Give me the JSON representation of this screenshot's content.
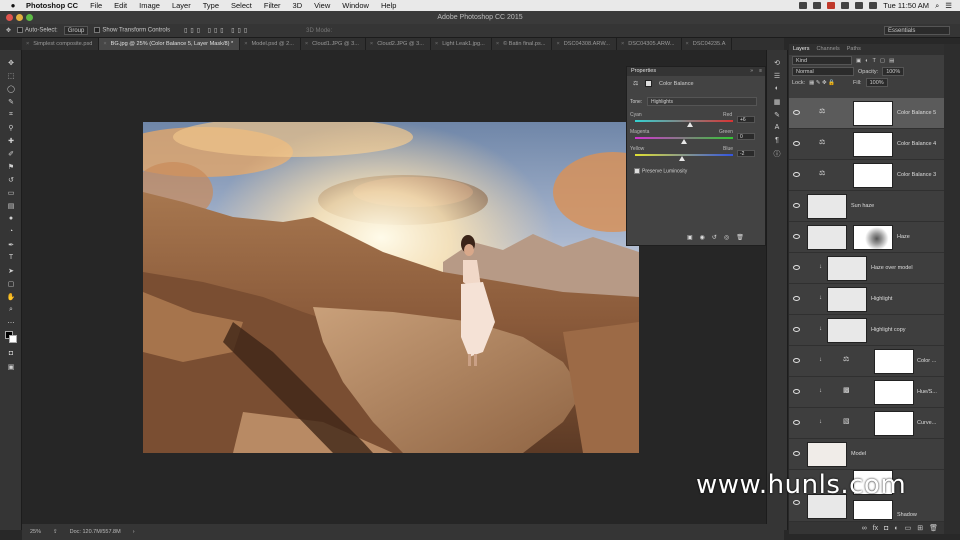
{
  "menubar": {
    "app": "Photoshop CC",
    "menus": [
      "File",
      "Edit",
      "Image",
      "Layer",
      "Type",
      "Select",
      "Filter",
      "3D",
      "View",
      "Window",
      "Help"
    ],
    "clock": "Tue 11:50 AM"
  },
  "window": {
    "title": "Adobe Photoshop CC 2015"
  },
  "options": {
    "auto_select_label": "Auto-Select:",
    "auto_select_value": "Group",
    "transform_label": "Show Transform Controls",
    "mode_3d": "3D Mode:",
    "workspace": "Essentials"
  },
  "tabs": [
    {
      "label": "Simplest composite.psd",
      "active": false
    },
    {
      "label": "BG.jpg @ 25% (Color Balance 5, Layer Mask/8) *",
      "active": true
    },
    {
      "label": "Model.psd @ 2...",
      "active": false
    },
    {
      "label": "Cloud1.JPG @ 3...",
      "active": false
    },
    {
      "label": "Cloud2.JPG @ 3...",
      "active": false
    },
    {
      "label": "Light Leak1.jpg...",
      "active": false
    },
    {
      "label": "© Batin final.ps...",
      "active": false
    },
    {
      "label": "DSC04308.ARW...",
      "active": false
    },
    {
      "label": "DSC04305.ARW...",
      "active": false
    },
    {
      "label": "DSC04235.A",
      "active": false
    }
  ],
  "tools": [
    "move-icon",
    "marquee-icon",
    "lasso-icon",
    "quick-select-icon",
    "crop-icon",
    "eyedropper-icon",
    "healing-icon",
    "brush-icon",
    "stamp-icon",
    "history-brush-icon",
    "eraser-icon",
    "gradient-icon",
    "blur-icon",
    "dodge-icon",
    "pen-icon",
    "type-icon",
    "path-select-icon",
    "shape-icon",
    "hand-icon",
    "zoom-icon",
    "more-icon"
  ],
  "properties": {
    "title": "Properties",
    "adjustment": "Color Balance",
    "tone_label": "Tone:",
    "tone_value": "Highlights",
    "sliders": [
      {
        "left": "Cyan",
        "right": "Red",
        "value": "+6",
        "pos": 0.56
      },
      {
        "left": "Magenta",
        "right": "Green",
        "value": "0",
        "pos": 0.5
      },
      {
        "left": "Yellow",
        "right": "Blue",
        "value": "-2",
        "pos": 0.48
      }
    ],
    "preserve": "Preserve Luminosity"
  },
  "layers_panel": {
    "tabs": [
      "Layers",
      "Channels",
      "Paths"
    ],
    "kind": "Kind",
    "blend": "Normal",
    "opacity_label": "Opacity:",
    "opacity": "100%",
    "lock_label": "Lock:",
    "fill_label": "Fill:",
    "fill": "100%",
    "layers": [
      {
        "name": "Color Balance 5",
        "type": "adj",
        "selected": true
      },
      {
        "name": "Color Balance 4",
        "type": "adj",
        "selected": false
      },
      {
        "name": "Color Balance 3",
        "type": "adj",
        "selected": false
      },
      {
        "name": "Sun haze",
        "type": "pixel",
        "selected": false
      },
      {
        "name": "Haze",
        "type": "pixel",
        "selected": false
      },
      {
        "name": "Haze over model",
        "type": "clip",
        "selected": false
      },
      {
        "name": "Highlight",
        "type": "clip",
        "selected": false
      },
      {
        "name": "Highlight copy",
        "type": "clip",
        "selected": false
      },
      {
        "name": "Color ...",
        "type": "clipadj",
        "selected": false
      },
      {
        "name": "Hue/S...",
        "type": "clipadj",
        "selected": false
      },
      {
        "name": "Curve...",
        "type": "clipadj",
        "selected": false
      },
      {
        "name": "Model",
        "type": "pixel",
        "selected": false
      },
      {
        "name": "Shadow",
        "type": "pixel",
        "selected": false
      }
    ]
  },
  "status": {
    "zoom": "25%",
    "doc": "Doc: 120.7M/557.8M"
  },
  "watermark": "www.hunls.com"
}
